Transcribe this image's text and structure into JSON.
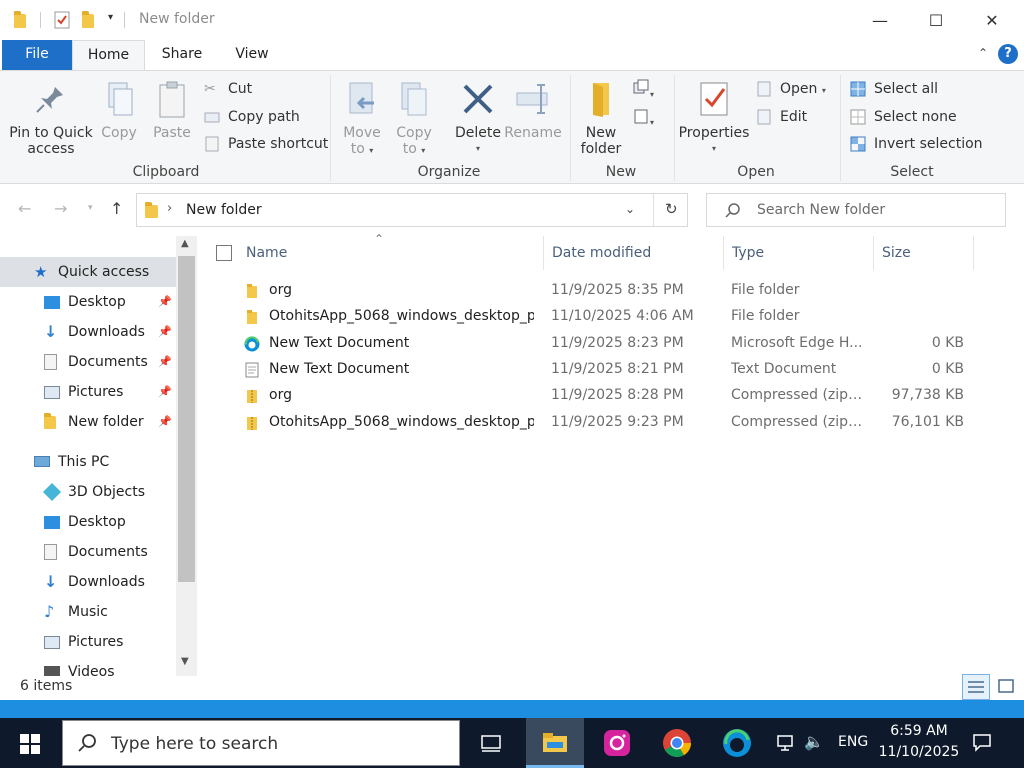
{
  "window": {
    "title": "New folder",
    "controls": {
      "minimize": "—",
      "maximize": "☐",
      "close": "✕"
    }
  },
  "tabs": {
    "file": "File",
    "home": "Home",
    "share": "Share",
    "view": "View",
    "help": "?"
  },
  "ribbon": {
    "clipboard": {
      "pin_line1": "Pin to Quick",
      "pin_line2": "access",
      "copy": "Copy",
      "paste": "Paste",
      "cut": "Cut",
      "copy_path": "Copy path",
      "paste_shortcut": "Paste shortcut",
      "group": "Clipboard"
    },
    "organize": {
      "move_line1": "Move",
      "move_line2": "to",
      "copy_line1": "Copy",
      "copy_line2": "to",
      "delete": "Delete",
      "rename": "Rename",
      "group": "Organize"
    },
    "new": {
      "line1": "New",
      "line2": "folder",
      "group": "New"
    },
    "open": {
      "properties": "Properties",
      "open": "Open",
      "edit": "Edit",
      "group": "Open"
    },
    "select": {
      "select_all": "Select all",
      "select_none": "Select none",
      "invert": "Invert selection",
      "group": "Select"
    }
  },
  "address": {
    "path": "New folder",
    "search_placeholder": "Search New folder"
  },
  "nav": {
    "quick_access": "Quick access",
    "quick_items": [
      "Desktop",
      "Downloads",
      "Documents",
      "Pictures",
      "New folder"
    ],
    "this_pc": "This PC",
    "pc_items": [
      "3D Objects",
      "Desktop",
      "Documents",
      "Downloads",
      "Music",
      "Pictures",
      "Videos"
    ]
  },
  "columns": {
    "name": "Name",
    "date": "Date modified",
    "type": "Type",
    "size": "Size"
  },
  "files": [
    {
      "name": "org",
      "date": "11/9/2025 8:35 PM",
      "type": "File folder",
      "size": "",
      "icon": "folder-icon"
    },
    {
      "name": "OtohitsApp_5068_windows_desktop_p...",
      "date": "11/10/2025 4:06 AM",
      "type": "File folder",
      "size": "",
      "icon": "folder-icon"
    },
    {
      "name": "New Text Document",
      "date": "11/9/2025 8:23 PM",
      "type": "Microsoft Edge H...",
      "size": "0 KB",
      "icon": "edge-html-icon"
    },
    {
      "name": "New Text Document",
      "date": "11/9/2025 8:21 PM",
      "type": "Text Document",
      "size": "0 KB",
      "icon": "text-file-icon"
    },
    {
      "name": "org",
      "date": "11/9/2025 8:28 PM",
      "type": "Compressed (zipp...",
      "size": "97,738 KB",
      "icon": "zip-folder-icon"
    },
    {
      "name": "OtohitsApp_5068_windows_desktop_p...",
      "date": "11/9/2025 9:23 PM",
      "type": "Compressed (zipp...",
      "size": "76,101 KB",
      "icon": "zip-folder-icon"
    }
  ],
  "status": {
    "items": "6 items"
  },
  "taskbar": {
    "search_placeholder": "Type here to search",
    "language": "ENG",
    "time": "6:59 AM",
    "date": "11/10/2025"
  },
  "colors": {
    "accent": "#1e6fc8",
    "taskbar": "#0e1a2b",
    "folder": "#f3c74a",
    "status_accent": "#1e8ee0"
  }
}
